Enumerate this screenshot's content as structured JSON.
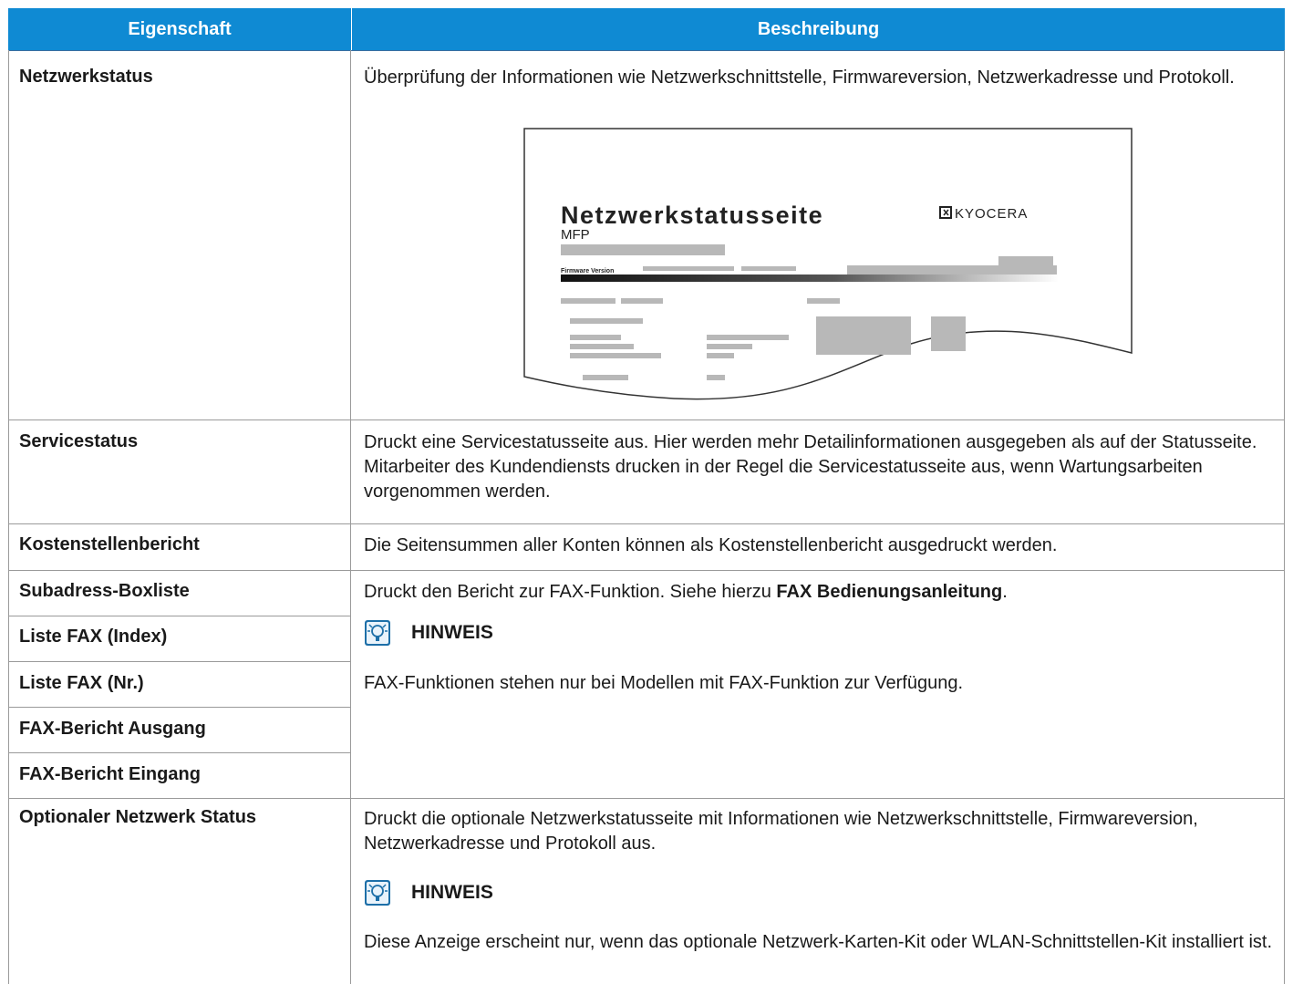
{
  "table": {
    "headers": {
      "property": "Eigenschaft",
      "description": "Beschreibung"
    },
    "rows": {
      "netzwerkstatus": {
        "property": "Netzwerkstatus",
        "description": "Überprüfung der Informationen wie Netzwerkschnittstelle, Firmwareversion, Netzwerkadresse und Protokoll."
      },
      "servicestatus": {
        "property": "Servicestatus",
        "description": "Druckt eine Servicestatusseite aus. Hier werden mehr Detailinformationen ausgegeben als auf der Statusseite. Mitarbeiter des Kundendiensts drucken in der Regel die Servicestatusseite aus, wenn Wartungsarbeiten vorgenommen werden."
      },
      "kostenstellen": {
        "property": "Kostenstellenbericht",
        "description": "Die Seitensummen aller Konten können als Kostenstellenbericht ausgedruckt werden."
      },
      "fax_group": {
        "properties": [
          "Subadress-Boxliste",
          "Liste FAX (Index)",
          "Liste FAX (Nr.)",
          "FAX-Bericht Ausgang",
          "FAX-Bericht Eingang"
        ],
        "description_prefix": "Druckt den Bericht zur FAX-Funktion. Siehe hierzu ",
        "description_bold": "FAX Bedienungsanleitung",
        "description_suffix": ".",
        "note_label": "HINWEIS",
        "note_text": "FAX-Funktionen stehen nur bei Modellen mit FAX-Funktion zur Verfügung."
      },
      "optional": {
        "property": "Optionaler Netzwerk Status",
        "description": "Druckt die optionale Netzwerkstatusseite mit Informationen wie Netzwerkschnittstelle, Firmwareversion, Netzwerkadresse und Protokoll aus.",
        "note_label": "HINWEIS",
        "note_text": "Diese Anzeige erscheint nur, wenn das optionale Netzwerk-Karten-Kit oder WLAN-Schnittstellen-Kit installiert ist."
      }
    }
  },
  "status_page_illustration": {
    "title": "Netzwerkstatusseite",
    "subtitle": "MFP",
    "firmware_label": "Firmware Version",
    "brand": "KYOCERA"
  },
  "colors": {
    "header_bg": "#0f8ad3",
    "grid": "#9a9a9a"
  },
  "icons": {
    "note": "lightbulb-note-icon"
  }
}
